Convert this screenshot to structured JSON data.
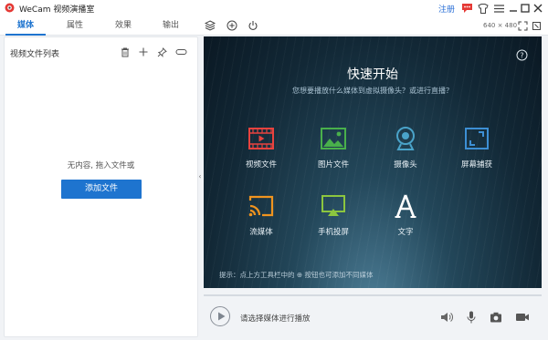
{
  "app": {
    "title": "WeCam 视频演播室",
    "register_label": "注册",
    "resolution": "640 × 480"
  },
  "tabs": [
    {
      "label": "媒体",
      "active": true
    },
    {
      "label": "属性",
      "active": false
    },
    {
      "label": "效果",
      "active": false
    },
    {
      "label": "输出",
      "active": false
    }
  ],
  "left_panel": {
    "title": "视频文件列表",
    "empty_text": "无内容, 拖入文件或",
    "add_button": "添加文件"
  },
  "preview": {
    "title": "快速开始",
    "subtitle": "您想要播放什么媒体到虚拟摄像头？或进行直播？",
    "items": [
      {
        "label": "视频文件",
        "icon": "film-icon",
        "color": "#e8433f"
      },
      {
        "label": "图片文件",
        "icon": "image-icon",
        "color": "#49b04b"
      },
      {
        "label": "摄像头",
        "icon": "webcam-icon",
        "color": "#4aa3c9"
      },
      {
        "label": "屏幕捕获",
        "icon": "screen-capture-icon",
        "color": "#3d8fd4"
      },
      {
        "label": "流媒体",
        "icon": "cast-icon",
        "color": "#f0941f"
      },
      {
        "label": "手机投屏",
        "icon": "phone-cast-icon",
        "color": "#8cc63f"
      },
      {
        "label": "文字",
        "icon": "text-icon",
        "color": "#ffffff"
      }
    ],
    "hint": "提示：点上方工具栏中的 ⊕ 按钮也可添加不同媒体"
  },
  "player": {
    "prompt": "请选择媒体进行播放"
  },
  "colors": {
    "accent": "#1e74cf",
    "register": "#2a6fd6",
    "danger": "#e53935"
  }
}
